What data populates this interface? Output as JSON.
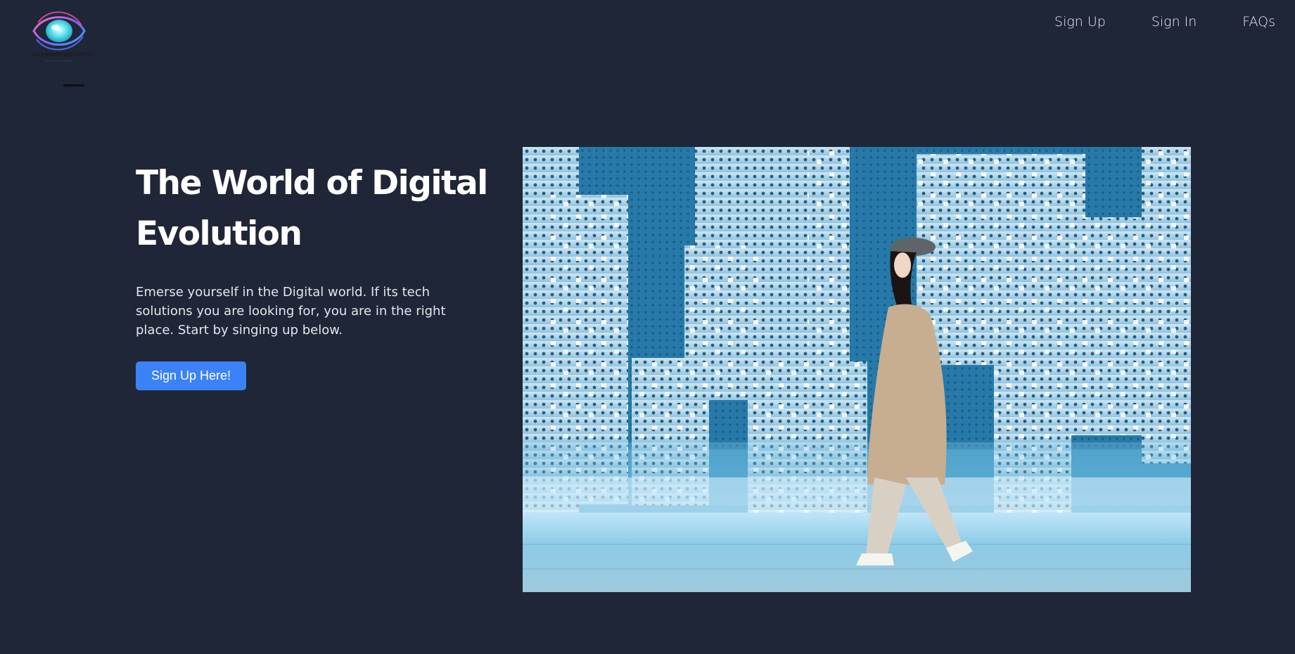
{
  "header": {
    "logo": {
      "text": "NETWORKSECURITY",
      "icon": "eye-logo-icon"
    },
    "nav": [
      {
        "label": "Sign Up"
      },
      {
        "label": "Sign In"
      },
      {
        "label": "FAQs"
      }
    ]
  },
  "hero": {
    "title": "The World of Digital Evolution",
    "description": "Emerse yourself in the Digital world. If its tech solutions you are looking for, you are in the right place. Start by singing up below.",
    "cta_label": "Sign Up Here!",
    "image": {
      "subject": "woman-walking-past-illuminated-city-installation"
    }
  },
  "colors": {
    "background": "#1f2637",
    "accent": "#3b82f6",
    "text": "#ffffff"
  }
}
